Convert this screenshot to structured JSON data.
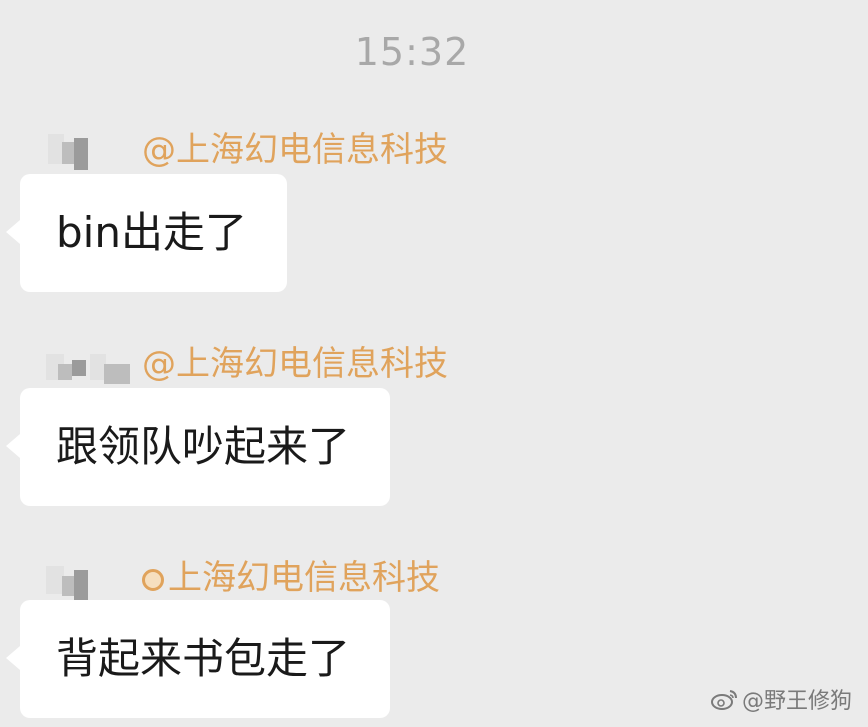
{
  "chat": {
    "timestamp": "15:32",
    "messages": [
      {
        "org": "@上海幻电信息科技",
        "text": "bin出走了"
      },
      {
        "org": "@上海幻电信息科技",
        "text": "跟领队吵起来了"
      },
      {
        "org": "上海幻电信息科技",
        "text": "背起来书包走了"
      }
    ]
  },
  "watermark": {
    "icon": "weibo-icon",
    "text": "@野王修狗"
  },
  "colors": {
    "background": "#ebebeb",
    "bubble": "#ffffff",
    "org_label": "#e0a35c",
    "timestamp": "#a8a8a8"
  }
}
